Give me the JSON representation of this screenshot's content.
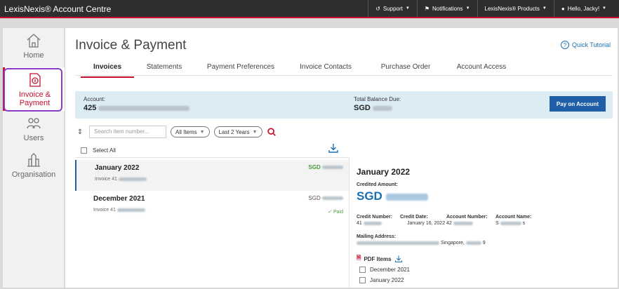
{
  "topbar": {
    "brand": "LexisNexis® Account Centre",
    "support": "Support",
    "notifications": "Notifications",
    "products": "LexisNexis® Products",
    "user": "Hello, Jacky!"
  },
  "sidebar": {
    "items": [
      {
        "label": "Home"
      },
      {
        "label": "Invoice & Payment"
      },
      {
        "label": "Users"
      },
      {
        "label": "Organisation"
      }
    ]
  },
  "page": {
    "title": "Invoice & Payment",
    "tutorial": "Quick Tutorial",
    "tabs": [
      "Invoices",
      "Statements",
      "Payment Preferences",
      "Invoice Contacts",
      "Purchase Order",
      "Account Access"
    ]
  },
  "account": {
    "account_label": "Account:",
    "account_value": "425",
    "balance_label": "Total Balance Due:",
    "balance_value": "SGD",
    "pay_button": "Pay on Account"
  },
  "filters": {
    "search_placeholder": "Search item number...",
    "items_filter": "All Items",
    "period_filter": "Last 2 Years"
  },
  "list": {
    "select_all": "Select All",
    "rows": [
      {
        "month": "January 2022",
        "invoice": "Invoice 41",
        "amount": "SGD",
        "status": ""
      },
      {
        "month": "December 2021",
        "invoice": "Invoice 41",
        "amount": "SGD",
        "status": "✓ Paid"
      }
    ]
  },
  "detail": {
    "title": "January 2022",
    "credited_label": "Credited Amount:",
    "credited_value": "SGD",
    "credit_number_label": "Credit Number:",
    "credit_number_value": "41",
    "credit_date_label": "Credit Date:",
    "credit_date_value": "January 16, 2022",
    "account_number_label": "Account Number:",
    "account_number_value": "42",
    "account_name_label": "Account Name:",
    "account_name_value": "S",
    "account_name_suffix": "s",
    "mailing_label": "Mailing Address:",
    "mailing_city": "Singapore,",
    "mailing_postal_suffix": "9",
    "pdf_label": "PDF Items",
    "pdf_items": [
      "December 2021",
      "January 2022"
    ]
  },
  "colors": {
    "brand_red": "#c8102e",
    "primary_blue": "#1f5fa8",
    "link_blue": "#1a6fb0",
    "paid_green": "#4a9a3a",
    "highlight_purple": "#8a3cc8"
  }
}
